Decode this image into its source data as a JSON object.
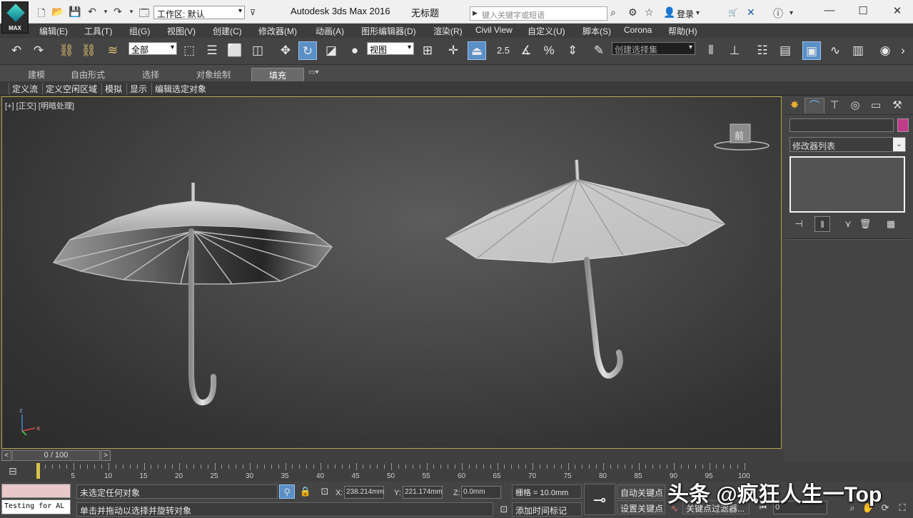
{
  "app": {
    "logo_label": "MAX",
    "workspace_label": "工作区: 默认",
    "app_title": "Autodesk 3ds Max 2016",
    "doc_title": "无标题",
    "search_placeholder": "键入关键字或短语",
    "login_label": "登录"
  },
  "menu": [
    "编辑(E)",
    "工具(T)",
    "组(G)",
    "视图(V)",
    "创建(C)",
    "修改器(M)",
    "动画(A)",
    "图形编辑器(D)",
    "渲染(R)",
    "Civil View",
    "自定义(U)",
    "脚本(S)",
    "Corona",
    "帮助(H)"
  ],
  "toolbar": {
    "selection_filter": "全部",
    "ref_coord": "视图",
    "snap_value": "2.5",
    "named_selection_placeholder": "创建选择集"
  },
  "ribbon": {
    "tabs": [
      "建模",
      "自由形式",
      "选择",
      "对象绘制",
      "填充"
    ],
    "active_tab": "填充",
    "sub_items": [
      "定义流",
      "定义空闲区域",
      "模拟",
      "显示",
      "编辑选定对象"
    ]
  },
  "viewport": {
    "label": "[+] [正交] [明暗处理]",
    "viewcube_face": "前"
  },
  "command_panel": {
    "modifier_list": "修改器列表",
    "object_color": "#c23b8a"
  },
  "timeline": {
    "frame_display": "0 / 100",
    "prev_label": "<",
    "next_label": ">",
    "labels": [
      "0",
      "5",
      "10",
      "15",
      "20",
      "25",
      "30",
      "35",
      "40",
      "45",
      "50",
      "55",
      "60",
      "65",
      "70",
      "75",
      "80",
      "85",
      "90",
      "95",
      "100"
    ]
  },
  "status": {
    "script_text": "Testing for AL",
    "selection_status": "未选定任何对象",
    "prompt": "单击并拖动以选择并旋转对象",
    "x_label": "X:",
    "x_value": "238.214mm",
    "y_label": "Y:",
    "y_value": "221.174mm",
    "z_label": "Z:",
    "z_value": "0.0mm",
    "grid": "栅格 = 10.0mm",
    "add_time_tag": "添加时间标记",
    "auto_key": "自动关键点",
    "set_key": "设置关键点",
    "key_filter": "关键点过滤器...",
    "frame_field": "0"
  },
  "watermark": "头条 @疯狂人生一Top"
}
